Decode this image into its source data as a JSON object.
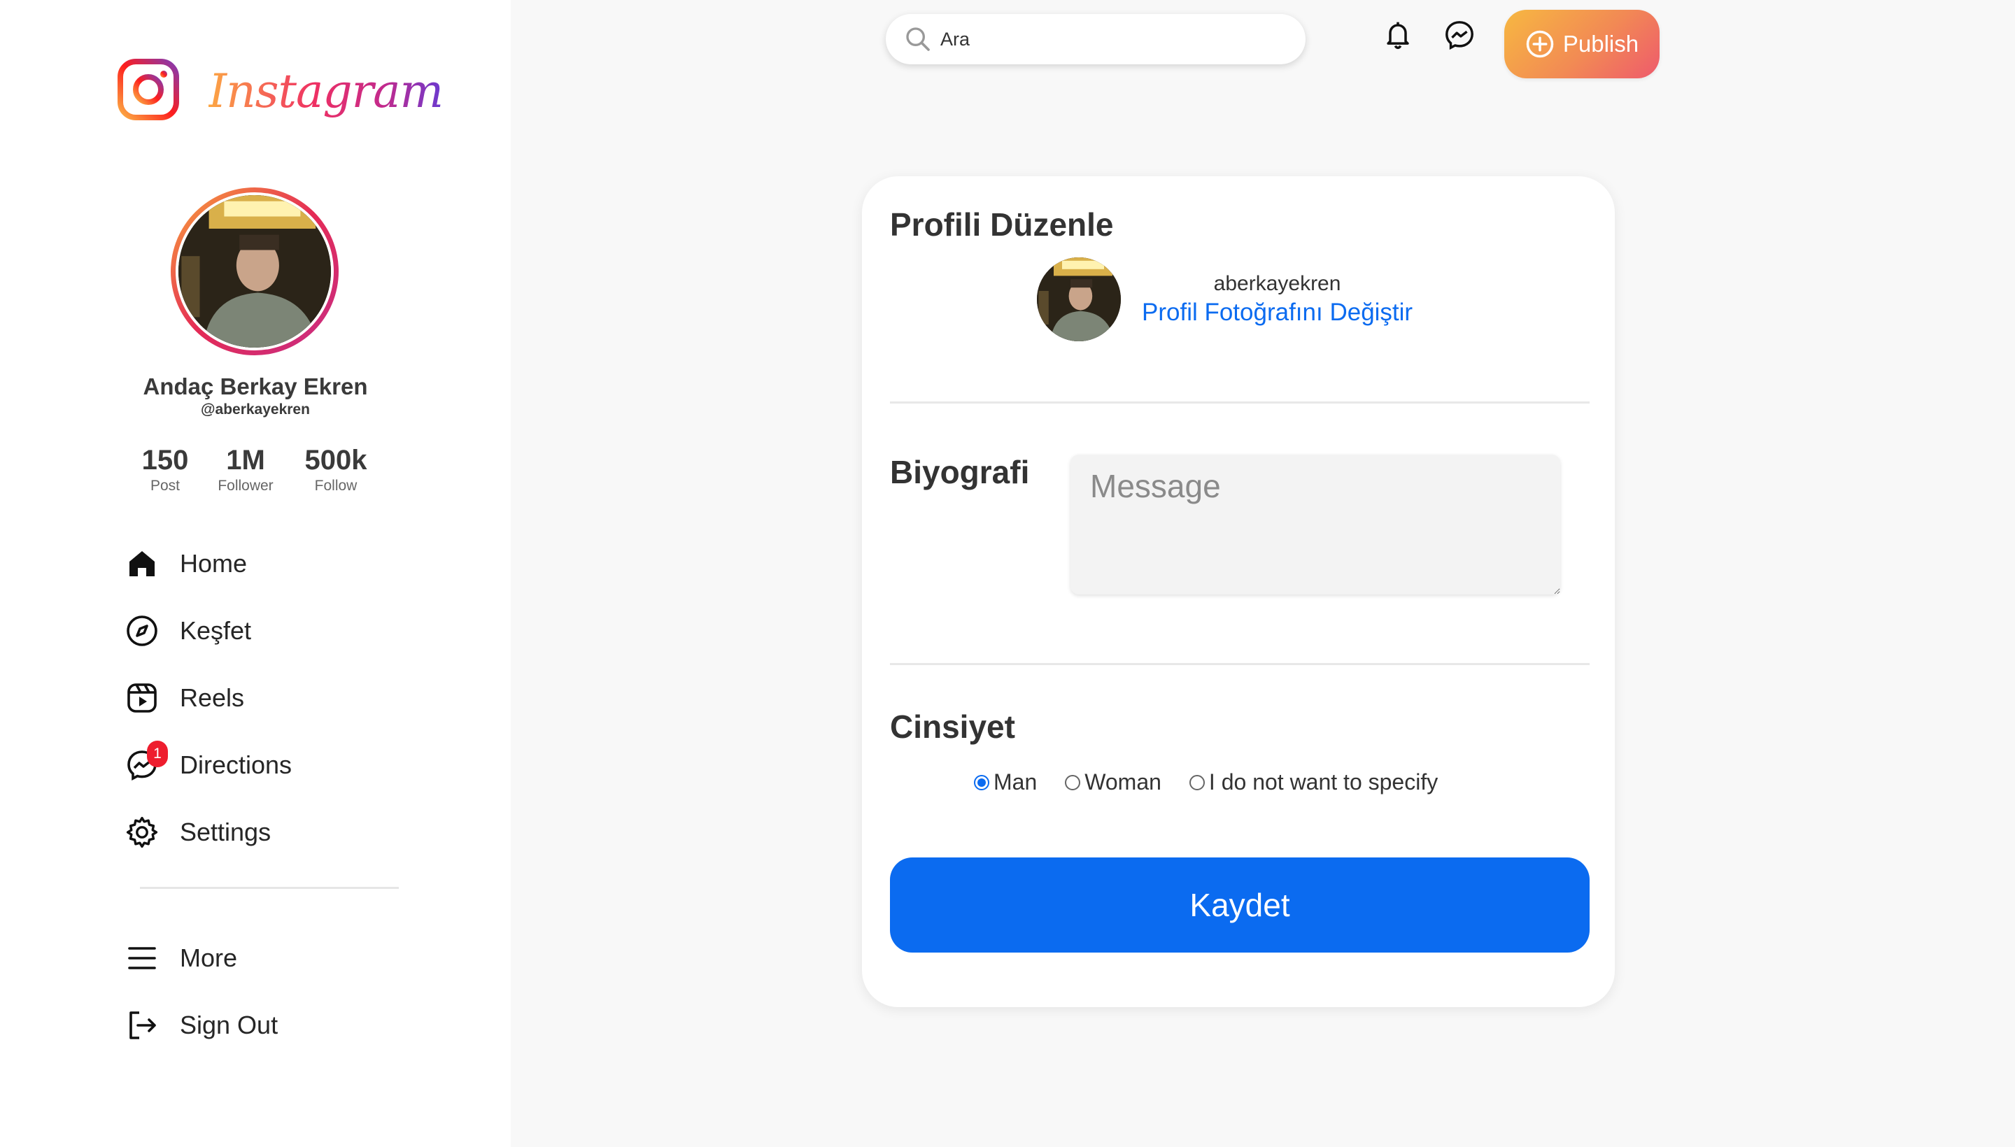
{
  "brand": {
    "wordmark": "Instagram"
  },
  "profile": {
    "name": "Andaç Berkay Ekren",
    "handle": "@aberkayekren",
    "stats": [
      {
        "value": "150",
        "label": "Post"
      },
      {
        "value": "1M",
        "label": "Follower"
      },
      {
        "value": "500k",
        "label": "Follow"
      }
    ]
  },
  "nav": {
    "items": [
      {
        "label": "Home",
        "icon": "home-icon"
      },
      {
        "label": "Keşfet",
        "icon": "compass-icon"
      },
      {
        "label": "Reels",
        "icon": "reels-icon"
      },
      {
        "label": "Directions",
        "icon": "messenger-icon",
        "badge": "1"
      },
      {
        "label": "Settings",
        "icon": "gear-icon"
      }
    ],
    "secondary": [
      {
        "label": "More",
        "icon": "menu-icon"
      },
      {
        "label": "Sign Out",
        "icon": "sign-out-icon"
      }
    ]
  },
  "topbar": {
    "search_placeholder": "Ara",
    "publish_label": "Publish"
  },
  "edit": {
    "title": "Profili Düzenle",
    "username": "aberkayekren",
    "change_photo": "Profil Fotoğrafını Değiştir",
    "bio_label": "Biyografi",
    "bio_placeholder": "Message",
    "gender_label": "Cinsiyet",
    "gender_options": [
      "Man",
      "Woman",
      "I do not want to specify"
    ],
    "gender_selected": "Man",
    "save_label": "Kaydet"
  },
  "colors": {
    "accent": "#0b6bf0",
    "badge": "#ee1d2e",
    "background": "#f8f8f8"
  }
}
